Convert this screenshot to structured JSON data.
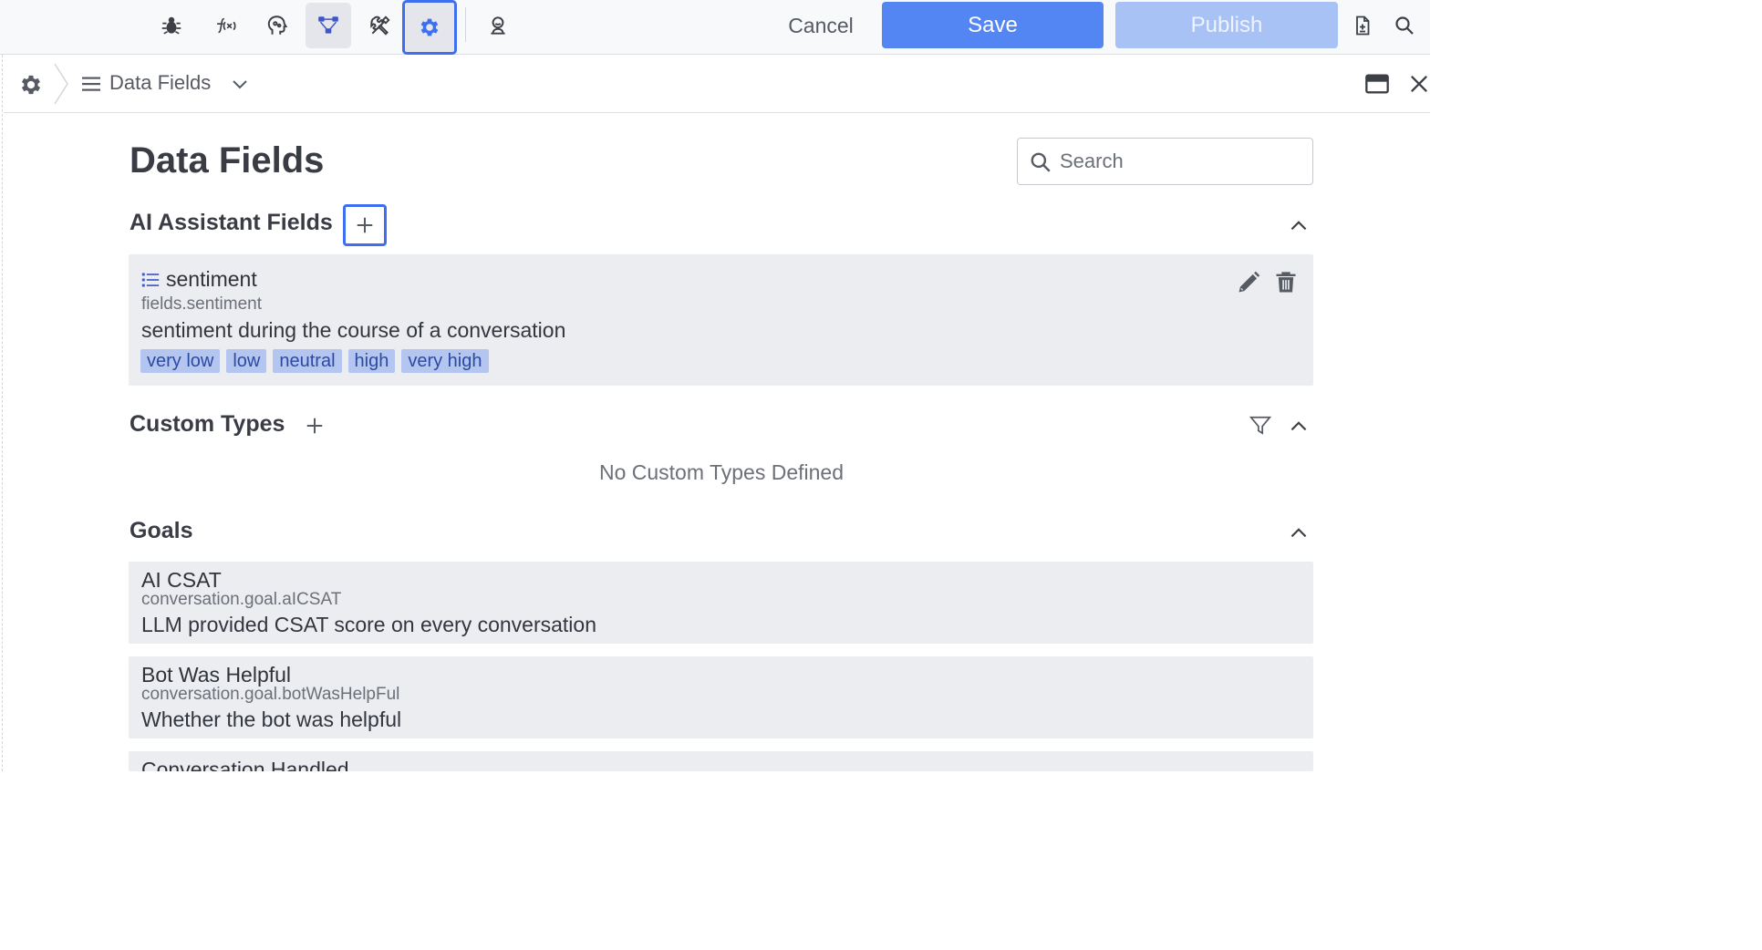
{
  "toolbar": {
    "icons": [
      "bug-icon",
      "function-icon",
      "ai-head-icon",
      "flow-icon",
      "tools-icon",
      "settings-gear-icon",
      "agent-icon"
    ],
    "cancel_label": "Cancel",
    "save_label": "Save",
    "publish_label": "Publish",
    "right_icons": [
      "document-icon",
      "search-icon"
    ]
  },
  "breadcrumb": {
    "label": "Data Fields"
  },
  "page": {
    "title": "Data Fields",
    "search_placeholder": "Search"
  },
  "ai_fields": {
    "title": "AI Assistant Fields",
    "items": [
      {
        "name": "sentiment",
        "path": "fields.sentiment",
        "description": "sentiment during the course of a conversation",
        "tags": [
          "very low",
          "low",
          "neutral",
          "high",
          "very high"
        ]
      }
    ]
  },
  "custom_types": {
    "title": "Custom Types",
    "empty_message": "No Custom Types Defined"
  },
  "goals": {
    "title": "Goals",
    "items": [
      {
        "name": "AI CSAT",
        "path": "conversation.goal.aICSAT",
        "description": "LLM provided CSAT score on every conversation"
      },
      {
        "name": "Bot Was Helpful",
        "path": "conversation.goal.botWasHelpFul",
        "description": "Whether the bot was helpful"
      },
      {
        "name": "Conversation Handled",
        "path": "",
        "description": ""
      }
    ]
  },
  "colors": {
    "accent": "#3d6ff0",
    "save": "#5486f3",
    "publish_disabled": "#a9c2f6",
    "card": "#ecedf1",
    "tag_bg": "#b4c6f0"
  }
}
